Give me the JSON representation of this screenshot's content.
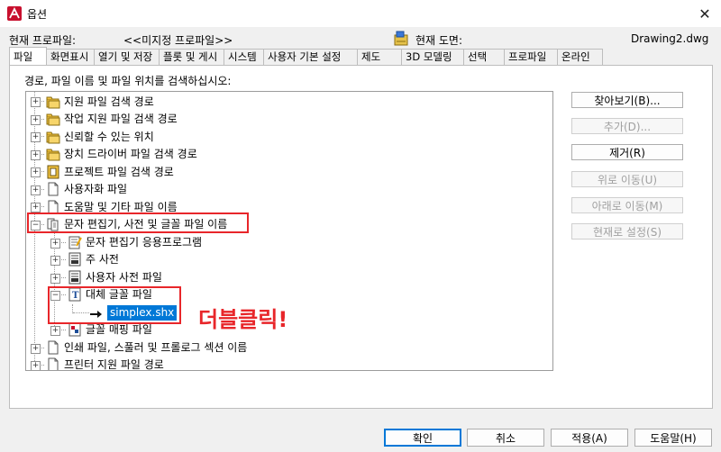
{
  "window": {
    "title": "옵션"
  },
  "profile": {
    "current_profile_label": "현재 프로파일:",
    "current_profile_value": "<<미지정 프로파일>>",
    "current_drawing_label": "현재 도면:",
    "current_drawing_value": "Drawing2.dwg"
  },
  "tabs": [
    {
      "label": "파일"
    },
    {
      "label": "화면표시"
    },
    {
      "label": "열기 및 저장"
    },
    {
      "label": "플롯 및 게시"
    },
    {
      "label": "시스템"
    },
    {
      "label": "사용자 기본 설정"
    },
    {
      "label": "제도"
    },
    {
      "label": "3D 모델링"
    },
    {
      "label": "선택"
    },
    {
      "label": "프로파일"
    },
    {
      "label": "온라인"
    }
  ],
  "tree_caption": "경로, 파일 이름 및 파일 위치를 검색하십시오:",
  "tree": [
    {
      "label": "지원 파일 검색 경로",
      "icon": "folder-stack-icon"
    },
    {
      "label": "작업 지원 파일 검색 경로",
      "icon": "folder-stack-icon"
    },
    {
      "label": "신뢰할 수 있는 위치",
      "icon": "folder-stack-icon"
    },
    {
      "label": "장치 드라이버 파일 검색 경로",
      "icon": "folder-stack-icon"
    },
    {
      "label": "프로젝트 파일 검색 경로",
      "icon": "project-icon"
    },
    {
      "label": "사용자화 파일",
      "icon": "file-icon"
    },
    {
      "label": "도움말 및 기타 파일 이름",
      "icon": "file-icon"
    },
    {
      "label": "문자 편집기, 사전 및 글꼴 파일 이름",
      "icon": "text-files-icon"
    },
    {
      "label": "문자 편집기 응용프로그램",
      "icon": "text-editor-icon"
    },
    {
      "label": "주 사전",
      "icon": "dictionary-icon"
    },
    {
      "label": "사용자 사전 파일",
      "icon": "dictionary-icon"
    },
    {
      "label": "대체 글꼴 파일",
      "icon": "font-icon"
    },
    {
      "label": "simplex.shx",
      "icon": "arrow-icon"
    },
    {
      "label": "글꼴 매핑 파일",
      "icon": "font-map-icon"
    },
    {
      "label": "인쇄 파일, 스풀러 및 프롤로그 섹션 이름",
      "icon": "file-icon"
    },
    {
      "label": "프린터 지원 파일 경로",
      "icon": "file-icon"
    }
  ],
  "side_buttons": {
    "browse": "찾아보기(B)...",
    "add": "추가(D)...",
    "remove": "제거(R)",
    "move_up": "위로 이동(U)",
    "move_down": "아래로 이동(M)",
    "set_current": "현재로 설정(S)"
  },
  "annotation": {
    "text": "더블클릭!",
    "color": "#e8262a"
  },
  "bottom_buttons": {
    "ok": "확인",
    "cancel": "취소",
    "apply": "적용(A)",
    "help": "도움말(H)"
  },
  "colors": {
    "selection": "#0078d7",
    "annotation": "#e8262a"
  }
}
